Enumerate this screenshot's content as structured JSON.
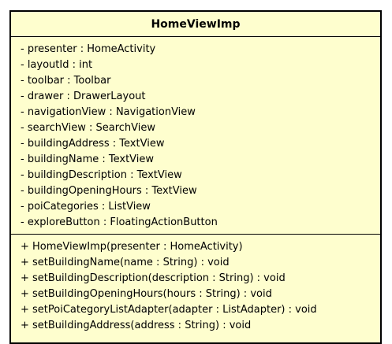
{
  "class": {
    "name": "HomeViewImp",
    "attributes": [
      "- presenter : HomeActivity",
      "- layoutId : int",
      "- toolbar : Toolbar",
      "- drawer : DrawerLayout",
      "- navigationView : NavigationView",
      "- searchView : SearchView",
      "- buildingAddress : TextView",
      "- buildingName : TextView",
      "- buildingDescription : TextView",
      "- buildingOpeningHours : TextView",
      "- poiCategories : ListView",
      "- exploreButton : FloatingActionButton"
    ],
    "operations": [
      "+ HomeViewImp(presenter : HomeActivity)",
      "+ setBuildingName(name : String) : void",
      "+ setBuildingDescription(description : String) : void",
      "+ setBuildingOpeningHours(hours : String) : void",
      "+ setPoiCategoryListAdapter(adapter : ListAdapter) : void",
      "+ setBuildingAddress(address : String) : void"
    ],
    "colors": {
      "fill": "#fefece",
      "border": "#000000",
      "text": "#000000"
    }
  }
}
